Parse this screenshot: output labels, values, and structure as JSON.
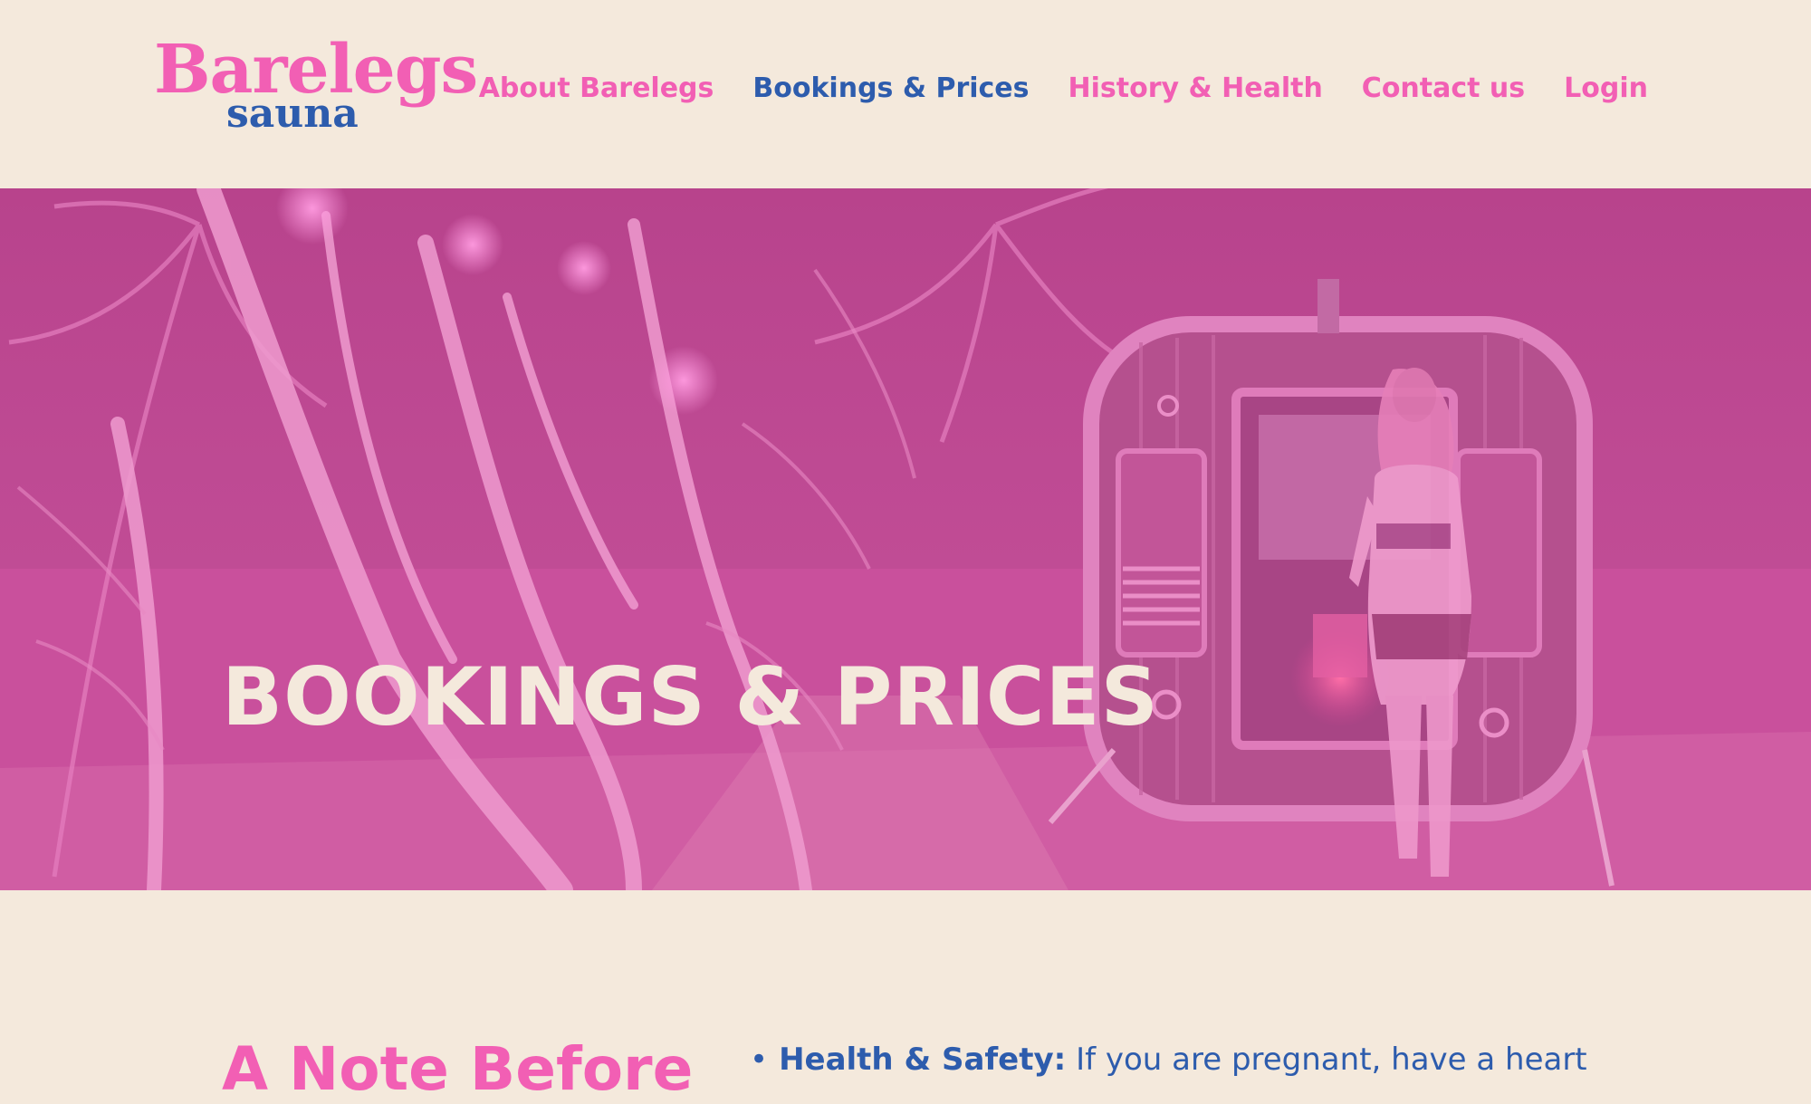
{
  "brand": {
    "logo_main": "Barelegs",
    "logo_sub": "sauna"
  },
  "nav": {
    "items": [
      {
        "label": "About Barelegs",
        "active": false
      },
      {
        "label": "Bookings & Prices",
        "active": true
      },
      {
        "label": "History & Health",
        "active": false
      },
      {
        "label": "Contact us",
        "active": false
      },
      {
        "label": "Login",
        "active": false
      }
    ]
  },
  "hero": {
    "title": "BOOKINGS & PRICES",
    "image": "sauna-garden-night-photo"
  },
  "content": {
    "heading": "A Note Before",
    "bullets": [
      {
        "strong": "Health & Safety:",
        "text": " If you are pregnant, have a heart"
      }
    ]
  },
  "colors": {
    "background": "#f4e9dc",
    "brand_pink": "#f25fb4",
    "brand_blue": "#2d5cad",
    "hero_overlay": "#c9509c",
    "hero_text": "#f4e9dc"
  }
}
